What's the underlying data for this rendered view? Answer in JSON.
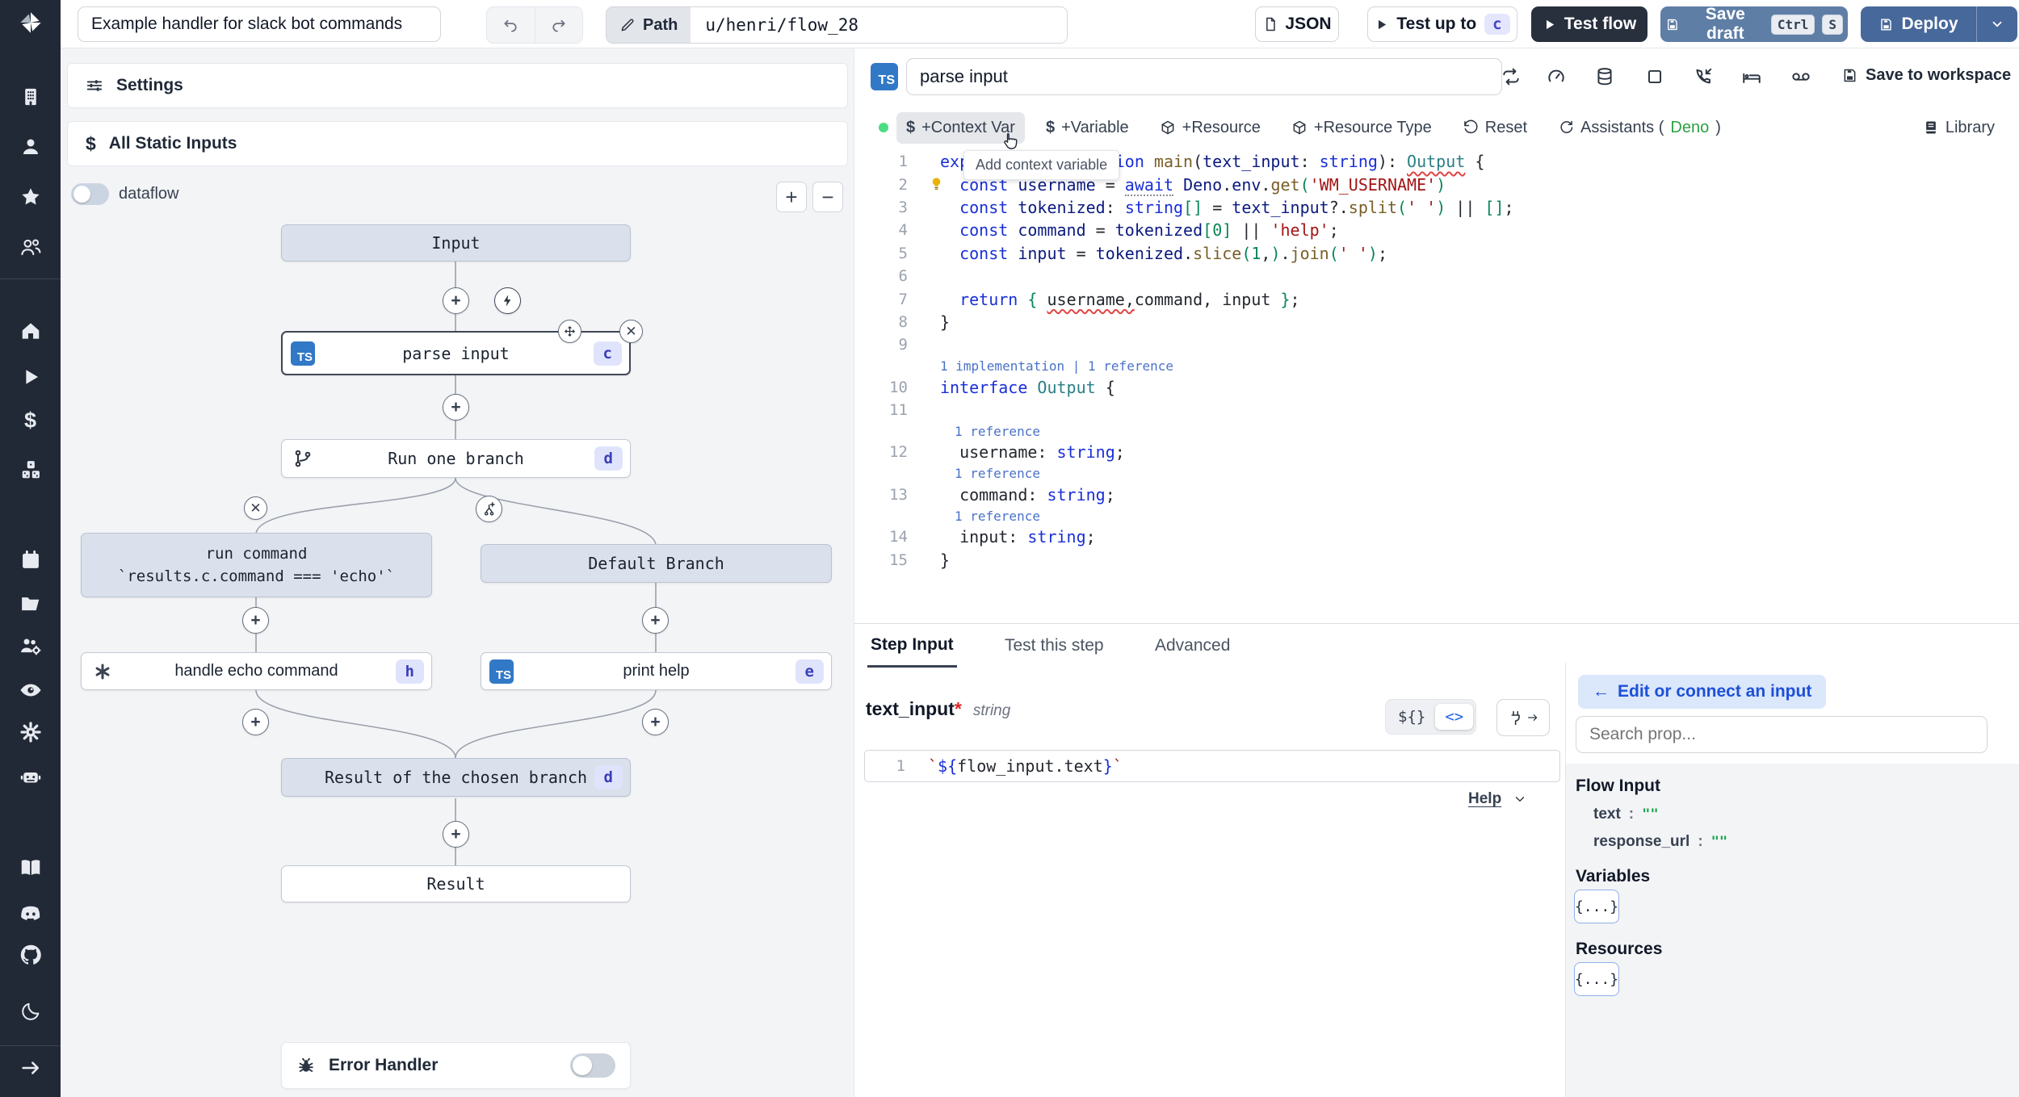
{
  "topbar": {
    "title_value": "Example handler for slack bot commands",
    "path_label": "Path",
    "path_value": "u/henri/flow_28",
    "json_button": "JSON",
    "test_up_to": "Test up to",
    "test_up_to_badge": "c",
    "test_flow": "Test flow",
    "save_draft": "Save draft",
    "kbd1": "Ctrl",
    "kbd2": "S",
    "deploy": "Deploy"
  },
  "flow_panel": {
    "settings": "Settings",
    "all_static_inputs": "All Static Inputs",
    "dataflow_label": "dataflow",
    "zoom_in": "+",
    "zoom_out": "−",
    "nodes": {
      "input": "Input",
      "parse_input": {
        "label": "parse input",
        "badge": "c",
        "lang": "TS"
      },
      "run_one_branch": {
        "label": "Run one branch",
        "badge": "d"
      },
      "run_command_line1": "run command",
      "run_command_line2": "`results.c.command === 'echo'`",
      "default_branch": "Default Branch",
      "handle_echo": {
        "label": "handle echo command",
        "badge": "h"
      },
      "print_help": {
        "label": "print help",
        "badge": "e",
        "lang": "TS"
      },
      "result_chosen": {
        "label": "Result of the chosen branch",
        "badge": "d"
      },
      "result": "Result",
      "error_handler": "Error Handler"
    },
    "plus_glyph": "+",
    "close_glyph": "✕"
  },
  "editor": {
    "lang_badge": "TS",
    "name_value": "parse input",
    "save_to_workspace": "Save to workspace",
    "toolbar": {
      "context_var": "+Context Var",
      "variable": "+Variable",
      "resource": "+Resource",
      "resource_type": "+Resource Type",
      "reset": "Reset",
      "assistants_prefix": "Assistants (",
      "assistants_lang": "Deno",
      "assistants_suffix": ")",
      "library": "Library",
      "dollar": "$"
    },
    "tooltip": "Add context variable",
    "code": {
      "entries": [
        {
          "type": "line",
          "num": "1",
          "tokens": [
            [
              "kw",
              "export "
            ],
            [
              "kw",
              "async "
            ],
            [
              "kw",
              "function "
            ],
            [
              "fn",
              "main"
            ],
            [
              "df",
              "("
            ],
            [
              "va",
              "text_input"
            ],
            [
              "df",
              ": "
            ],
            [
              "kw",
              "string"
            ],
            [
              "df",
              "): "
            ],
            [
              "ty sq",
              "Output"
            ],
            [
              "df",
              " {"
            ]
          ]
        },
        {
          "type": "line",
          "num": "2",
          "bulb": true,
          "tokens": [
            [
              "df",
              "  "
            ],
            [
              "kw",
              "const "
            ],
            [
              "va",
              "username"
            ],
            [
              "df",
              " = "
            ],
            [
              "kw hint",
              "await"
            ],
            [
              "df",
              " "
            ],
            [
              "va",
              "Deno"
            ],
            [
              "df",
              "."
            ],
            [
              "va",
              "env"
            ],
            [
              "df",
              "."
            ],
            [
              "fn",
              "get"
            ],
            [
              "br",
              "("
            ],
            [
              "st",
              "'WM_USERNAME'"
            ],
            [
              "br",
              ")"
            ]
          ]
        },
        {
          "type": "line",
          "num": "3",
          "tokens": [
            [
              "df",
              "  "
            ],
            [
              "kw",
              "const "
            ],
            [
              "va",
              "tokenized"
            ],
            [
              "df",
              ": "
            ],
            [
              "kw",
              "string"
            ],
            [
              "br",
              "[]"
            ],
            [
              "df",
              " = "
            ],
            [
              "va",
              "text_input"
            ],
            [
              "df",
              "?."
            ],
            [
              "fn",
              "split"
            ],
            [
              "br",
              "("
            ],
            [
              "st",
              "' '"
            ],
            [
              "br",
              ")"
            ],
            [
              "df",
              " || "
            ],
            [
              "br",
              "[]"
            ],
            [
              "df",
              ";"
            ]
          ]
        },
        {
          "type": "line",
          "num": "4",
          "tokens": [
            [
              "df",
              "  "
            ],
            [
              "kw",
              "const "
            ],
            [
              "va",
              "command"
            ],
            [
              "df",
              " = "
            ],
            [
              "va",
              "tokenized"
            ],
            [
              "br",
              "["
            ],
            [
              "nu",
              "0"
            ],
            [
              "br",
              "]"
            ],
            [
              "df",
              " || "
            ],
            [
              "st",
              "'help'"
            ],
            [
              "df",
              ";"
            ]
          ]
        },
        {
          "type": "line",
          "num": "5",
          "tokens": [
            [
              "df",
              "  "
            ],
            [
              "kw",
              "const "
            ],
            [
              "va",
              "input"
            ],
            [
              "df",
              " = "
            ],
            [
              "va",
              "tokenized"
            ],
            [
              "df",
              "."
            ],
            [
              "fn",
              "slice"
            ],
            [
              "br",
              "("
            ],
            [
              "nu",
              "1"
            ],
            [
              "df",
              ","
            ],
            [
              "br",
              ")"
            ],
            [
              "df",
              "."
            ],
            [
              "fn",
              "join"
            ],
            [
              "br",
              "("
            ],
            [
              "st",
              "' '"
            ],
            [
              "br",
              ")"
            ],
            [
              "df",
              ";"
            ]
          ]
        },
        {
          "type": "line",
          "num": "6",
          "tokens": []
        },
        {
          "type": "line",
          "num": "7",
          "tokens": [
            [
              "df",
              "  "
            ],
            [
              "kw",
              "return "
            ],
            [
              "br",
              "{ "
            ],
            [
              "df sq",
              "username,"
            ],
            [
              "df",
              "command, input "
            ],
            [
              "br",
              "}"
            ],
            [
              "df",
              ";"
            ]
          ]
        },
        {
          "type": "line",
          "num": "8",
          "tokens": [
            [
              "df",
              "}"
            ]
          ]
        },
        {
          "type": "line",
          "num": "9",
          "tokens": []
        },
        {
          "type": "lens",
          "tokens": [
            [
              "cl",
              "1 implementation | 1 reference"
            ]
          ]
        },
        {
          "type": "line",
          "num": "10",
          "tokens": [
            [
              "kw",
              "interface "
            ],
            [
              "ty",
              "Output"
            ],
            [
              "df",
              " {"
            ]
          ]
        },
        {
          "type": "line",
          "num": "11",
          "tokens": []
        },
        {
          "type": "lens",
          "indent": true,
          "tokens": [
            [
              "cl",
              "1 reference"
            ]
          ]
        },
        {
          "type": "line",
          "num": "12",
          "tokens": [
            [
              "df",
              "  username"
            ],
            [
              "df",
              ": "
            ],
            [
              "kw",
              "string"
            ],
            [
              "df",
              ";"
            ]
          ]
        },
        {
          "type": "lens",
          "indent": true,
          "tokens": [
            [
              "cl",
              "1 reference"
            ]
          ]
        },
        {
          "type": "line",
          "num": "13",
          "tokens": [
            [
              "df",
              "  command: "
            ],
            [
              "kw",
              "string"
            ],
            [
              "df",
              ";"
            ]
          ]
        },
        {
          "type": "lens",
          "indent": true,
          "tokens": [
            [
              "cl",
              "1 reference"
            ]
          ]
        },
        {
          "type": "line",
          "num": "14",
          "tokens": [
            [
              "df",
              "  input: "
            ],
            [
              "kw",
              "string"
            ],
            [
              "df",
              ";"
            ]
          ]
        },
        {
          "type": "line",
          "num": "15",
          "tokens": [
            [
              "df",
              "}"
            ]
          ]
        }
      ]
    }
  },
  "step_panel": {
    "tabs": [
      "Step Input",
      "Test this step",
      "Advanced"
    ],
    "field_name": "text_input",
    "required_mark": "*",
    "field_type": "string",
    "expr_line_num": "1",
    "expr_tokens": [
      [
        "st",
        "`"
      ],
      [
        "kw",
        "${"
      ],
      [
        "df",
        "flow_input.text"
      ],
      [
        "kw",
        "}"
      ],
      [
        "st",
        "`"
      ]
    ],
    "toggle_json": "${}",
    "toggle_code": "<>",
    "help": "Help"
  },
  "props_panel": {
    "edit_connect_arrow": "←",
    "edit_connect": "Edit or connect an input",
    "search_placeholder": "Search prop...",
    "flow_input_title": "Flow Input",
    "props": [
      {
        "name": "text",
        "colon": ":",
        "value": "\"\""
      },
      {
        "name": "response_url",
        "colon": ":",
        "value": "\"\""
      }
    ],
    "variables_title": "Variables",
    "resources_title": "Resources",
    "object_badge": "{...}"
  },
  "icons": {
    "windmill-logo": "pinwheel",
    "sidebar": [
      "building",
      "user",
      "star",
      "users",
      "home",
      "play",
      "dollar",
      "cubes",
      "calendar",
      "folder",
      "users-gear",
      "eye",
      "gear",
      "robot",
      "book",
      "discord",
      "github",
      "moon",
      "arrow-right"
    ],
    "editor_header": [
      "repeat",
      "gauge",
      "database",
      "square",
      "phone-incoming",
      "bed",
      "voicemail",
      "save"
    ],
    "flow": [
      "plus",
      "lightning",
      "move",
      "close",
      "git-branch",
      "branch-add",
      "script-hub",
      "bug"
    ]
  },
  "colors": {
    "sidebar_bg": "#222936",
    "ts_blue": "#3178c6",
    "badge_bg": "#dfe4fc",
    "badge_text": "#3b3fb8",
    "deno_green": "#2ea043",
    "save_draft_bg": "#5f7ea6",
    "deploy_bg": "#47689a",
    "test_flow_bg": "#28303e",
    "node_slate": "#dbe1ec",
    "edit_connect_bg": "#dbe7fb",
    "edit_connect_text": "#1d4fd8"
  }
}
